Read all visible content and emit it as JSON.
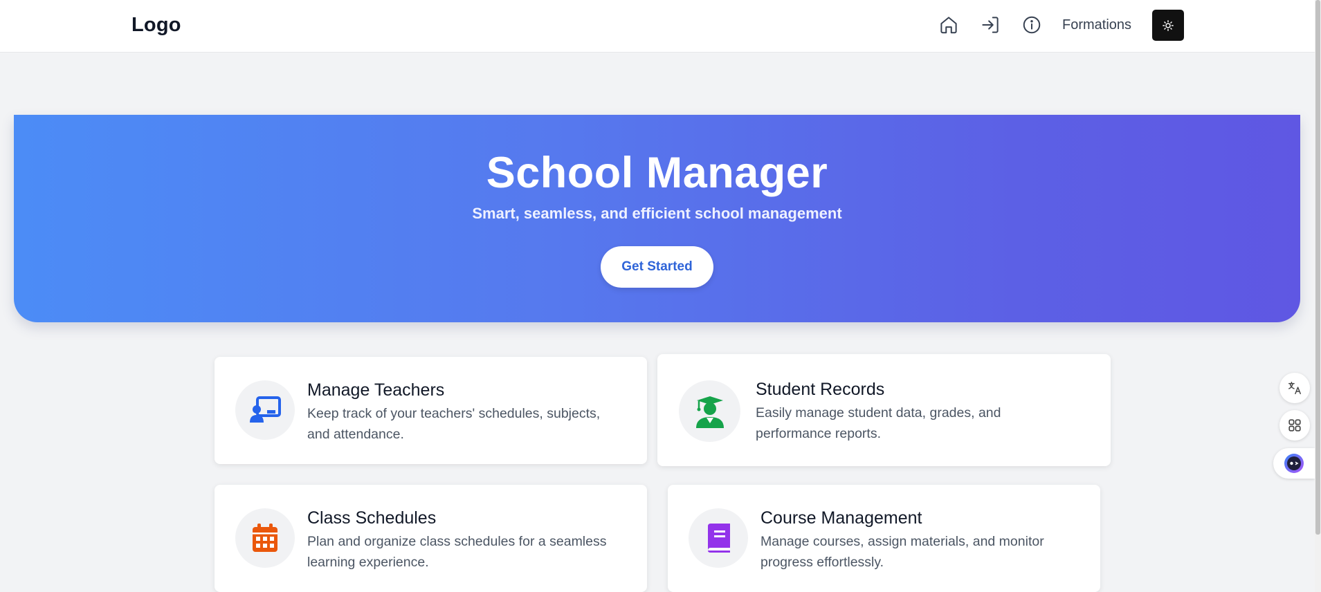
{
  "header": {
    "logo": "Logo",
    "nav": {
      "home_icon": "home-icon",
      "login_icon": "login-icon",
      "info_icon": "info-icon",
      "formations_label": "Formations",
      "theme_icon": "sun-icon"
    }
  },
  "hero": {
    "title": "School Manager",
    "subtitle": "Smart, seamless, and efficient school management",
    "cta_label": "Get Started"
  },
  "features": [
    {
      "title": "Manage Teachers",
      "description": "Keep track of your teachers' schedules, subjects, and attendance.",
      "icon": "chalkboard-teacher-icon",
      "icon_color": "#2563eb"
    },
    {
      "title": "Student Records",
      "description": "Easily manage student data, grades, and performance reports.",
      "icon": "graduate-icon",
      "icon_color": "#16a34a"
    },
    {
      "title": "Class Schedules",
      "description": "Plan and organize class schedules for a seamless learning experience.",
      "icon": "calendar-icon",
      "icon_color": "#ea580c"
    },
    {
      "title": "Course Management",
      "description": "Manage courses, assign materials, and monitor progress effortlessly.",
      "icon": "book-icon",
      "icon_color": "#9333ea"
    }
  ],
  "side_tools": [
    "translate-icon",
    "apps-icon",
    "assistant-icon"
  ],
  "colors": {
    "hero_start": "#4c8cf6",
    "hero_end": "#5f57e3",
    "cta_text": "#2f64d8",
    "theme_button": "#111111"
  }
}
